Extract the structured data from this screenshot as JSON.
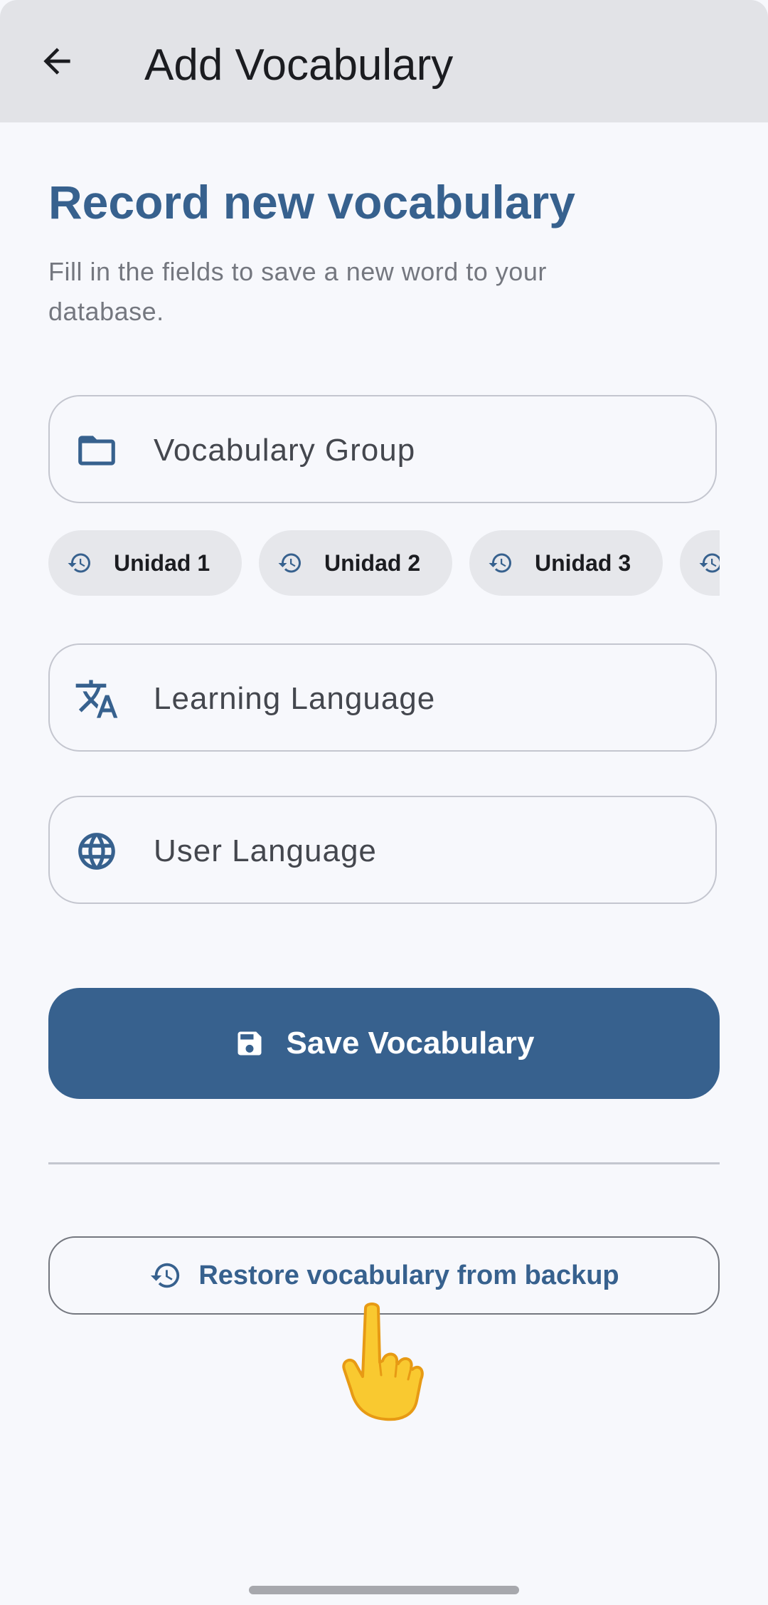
{
  "app_bar": {
    "title": "Add Vocabulary",
    "back_icon": "arrow-back-icon"
  },
  "header": {
    "heading": "Record new vocabulary",
    "subtitle": "Fill in the fields to save a new word to your database."
  },
  "fields": {
    "group": {
      "label": "Vocabulary Group",
      "icon": "folder-icon"
    },
    "learning_language": {
      "label": "Learning Language",
      "icon": "translate-icon"
    },
    "user_language": {
      "label": "User Language",
      "icon": "globe-icon"
    }
  },
  "recent_groups": {
    "icon": "history-icon",
    "chips": [
      {
        "label": "Unidad 1"
      },
      {
        "label": "Unidad 2"
      },
      {
        "label": "Unidad 3"
      },
      {
        "label": ""
      }
    ]
  },
  "save_button": {
    "label": "Save Vocabulary",
    "icon": "save-icon"
  },
  "restore_button": {
    "label": "Restore vocabulary from backup",
    "icon": "history-icon"
  },
  "colors": {
    "primary": "#37618e",
    "app_bar_bg": "#e2e3e7",
    "page_bg": "#f7f8fc",
    "outline": "#c4c6cf",
    "chip_bg": "#e6e7eb"
  }
}
